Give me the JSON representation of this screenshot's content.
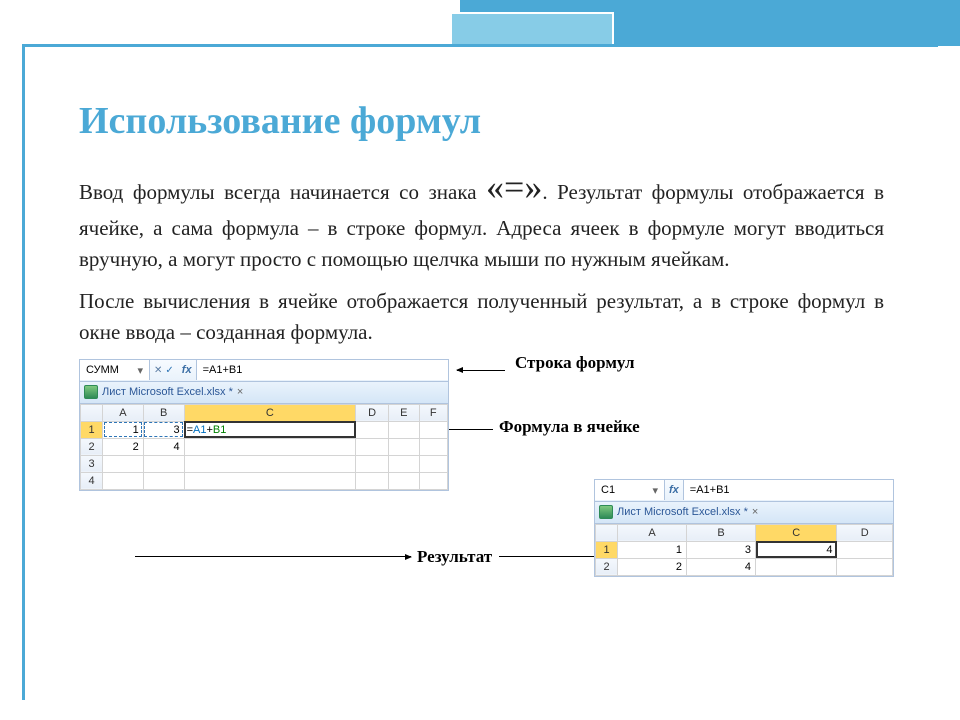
{
  "title": "Использование формул",
  "para1_a": "Ввод формулы всегда начинается со знака ",
  "equals": "«=»",
  "para1_b": ". Результат формулы отображается в ячейке, а сама формула – в строке формул. Адреса ячеек в формуле могут вводиться вручную, а могут просто с помощью щелчка мыши по нужным ячейкам.",
  "para2": "После вычисления в ячейке отображается полученный результат, а в строке формул в окне ввода – созданная формула.",
  "annotations": {
    "formula_bar": "Строка формул",
    "cell_formula": "Формула в ячейке",
    "result": "Результат"
  },
  "excel1": {
    "namebox": "СУММ",
    "fx": "fx",
    "formula": "=A1+B1",
    "tab": "Лист Microsoft Excel.xlsx *",
    "cols": [
      "A",
      "B",
      "C",
      "D",
      "E",
      "F"
    ],
    "rows": [
      "1",
      "2",
      "3",
      "4"
    ],
    "cells": {
      "r1": {
        "A": "1",
        "B": "3",
        "C": "=A1+B1"
      },
      "r2": {
        "A": "2",
        "B": "4"
      }
    }
  },
  "excel2": {
    "namebox": "C1",
    "fx": "fx",
    "formula": "=A1+B1",
    "tab": "Лист Microsoft Excel.xlsx *",
    "cols": [
      "A",
      "B",
      "C",
      "D"
    ],
    "rows": [
      "1",
      "2"
    ],
    "cells": {
      "r1": {
        "A": "1",
        "B": "3",
        "C": "4"
      },
      "r2": {
        "A": "2",
        "B": "4"
      }
    }
  }
}
